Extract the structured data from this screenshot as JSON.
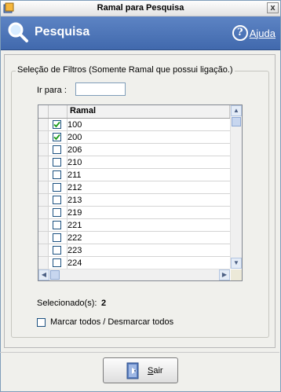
{
  "window": {
    "title": "Ramal para Pesquisa",
    "close_glyph": "x"
  },
  "header": {
    "title": "Pesquisa",
    "help_glyph": "?",
    "help_label": "Ajuda"
  },
  "filters": {
    "legend": "Seleção de Filtros (Somente Ramal que possui ligação.)",
    "goto_label": "Ir para :",
    "goto_value": ""
  },
  "grid": {
    "column_header": "Ramal",
    "rows": [
      {
        "ramal": "100",
        "checked": true
      },
      {
        "ramal": "200",
        "checked": true
      },
      {
        "ramal": "206",
        "checked": false
      },
      {
        "ramal": "210",
        "checked": false
      },
      {
        "ramal": "211",
        "checked": false
      },
      {
        "ramal": "212",
        "checked": false
      },
      {
        "ramal": "213",
        "checked": false
      },
      {
        "ramal": "219",
        "checked": false
      },
      {
        "ramal": "221",
        "checked": false
      },
      {
        "ramal": "222",
        "checked": false
      },
      {
        "ramal": "223",
        "checked": false
      },
      {
        "ramal": "224",
        "checked": false
      }
    ]
  },
  "selection": {
    "label": "Selecionado(s):",
    "count": "2"
  },
  "mark_all_label": "Marcar todos / Desmarcar todos",
  "exit_button": {
    "first_letter": "S",
    "rest": "air"
  },
  "colors": {
    "header_bg": "#4f77ba",
    "check": "#1a9b1a"
  }
}
